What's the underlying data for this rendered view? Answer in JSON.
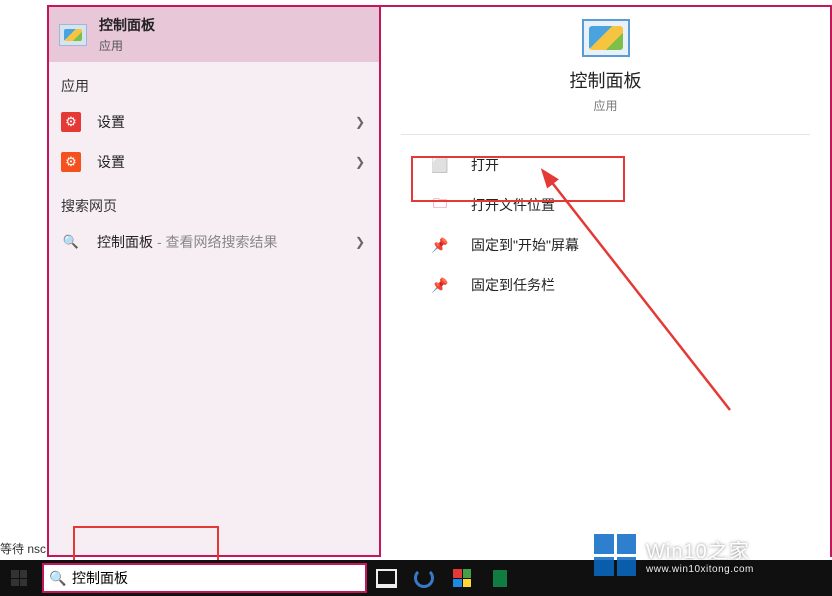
{
  "bestMatch": {
    "title": "控制面板",
    "subtitle": "应用"
  },
  "sections": {
    "apps": "应用",
    "web": "搜索网页"
  },
  "items": {
    "settings1": "设置",
    "settings2": "设置",
    "websearch": "控制面板",
    "websearch_sub": "- 查看网络搜索结果"
  },
  "detail": {
    "title": "控制面板",
    "subtitle": "应用",
    "actions": {
      "open": "打开",
      "openLocation": "打开文件位置",
      "pinStart": "固定到\"开始\"屏幕",
      "pinTaskbar": "固定到任务栏"
    }
  },
  "searchBox": {
    "value": "控制面板"
  },
  "waitText": "等待 nsc",
  "watermark": {
    "line1": "Win10之家",
    "line2": "www.win10xitong.com"
  }
}
